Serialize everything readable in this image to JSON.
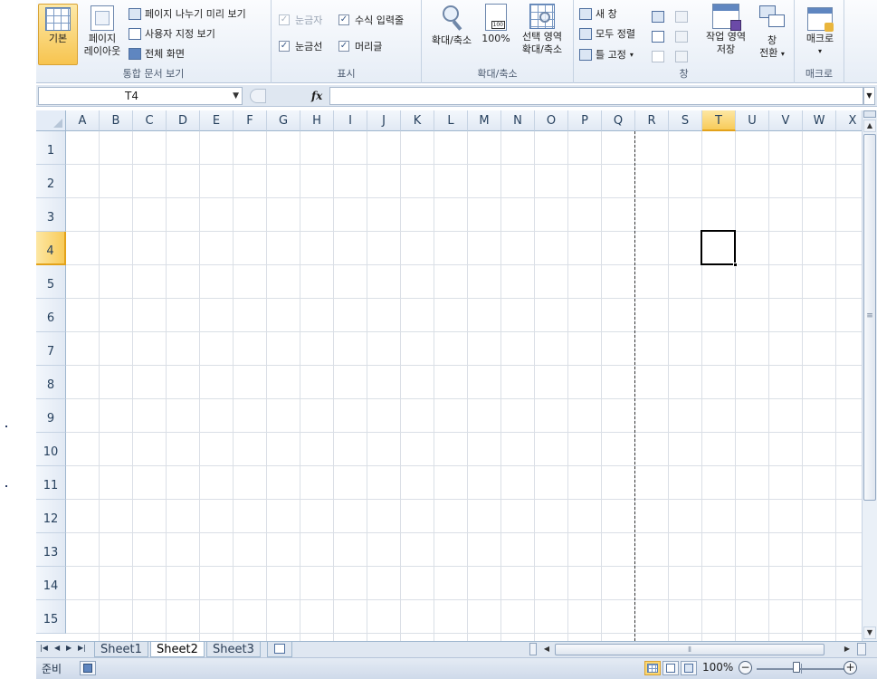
{
  "ribbon": {
    "workbook_views": {
      "label": "통합 문서 보기",
      "normal": "기본",
      "page_layout_line1": "페이지",
      "page_layout_line2": "레이아웃",
      "page_break_preview": "페이지 나누기 미리 보기",
      "custom_views": "사용자 지정 보기",
      "full_screen": "전체 화면"
    },
    "show": {
      "label": "표시",
      "ruler": "눈금자",
      "formula_bar": "수식 입력줄",
      "gridlines": "눈금선",
      "headings": "머리글",
      "ruler_checked": "✓",
      "formula_bar_checked": "✓",
      "gridlines_checked": "✓",
      "headings_checked": "✓"
    },
    "zoom": {
      "label": "확대/축소",
      "zoom": "확대/축소",
      "hundred": "100%",
      "zoom_to_selection_line1": "선택 영역",
      "zoom_to_selection_line2": "확대/축소",
      "icon_badge": "100"
    },
    "window": {
      "label": "창",
      "new_window": "새 창",
      "arrange_all": "모두 정렬",
      "freeze_panes": "틀 고정",
      "save_workspace_line1": "작업 영역",
      "save_workspace_line2": "저장",
      "switch_windows_line1": "창",
      "switch_windows_line2": "전환"
    },
    "macros": {
      "label": "매크로",
      "macros": "매크로"
    }
  },
  "formula_bar": {
    "name_box": "T4",
    "fx": "fx",
    "formula": ""
  },
  "grid": {
    "columns": [
      "A",
      "B",
      "C",
      "D",
      "E",
      "F",
      "G",
      "H",
      "I",
      "J",
      "K",
      "L",
      "M",
      "N",
      "O",
      "P",
      "Q",
      "R",
      "S",
      "T",
      "U",
      "V",
      "W",
      "X"
    ],
    "rows": [
      "1",
      "2",
      "3",
      "4",
      "5",
      "6",
      "7",
      "8",
      "9",
      "10",
      "11",
      "12",
      "13",
      "14",
      "15"
    ],
    "active_column": "T",
    "active_row": "4"
  },
  "sheets": {
    "tabs": [
      "Sheet1",
      "Sheet2",
      "Sheet3"
    ],
    "active": "Sheet2"
  },
  "status": {
    "text": "준비",
    "zoom": "100%",
    "zoom_minus": "−",
    "zoom_plus": "+"
  },
  "colors": {
    "active_header": "#f8cb5a",
    "ribbon_bg": "#e6edf6",
    "header_bg": "#e1e9f4"
  }
}
